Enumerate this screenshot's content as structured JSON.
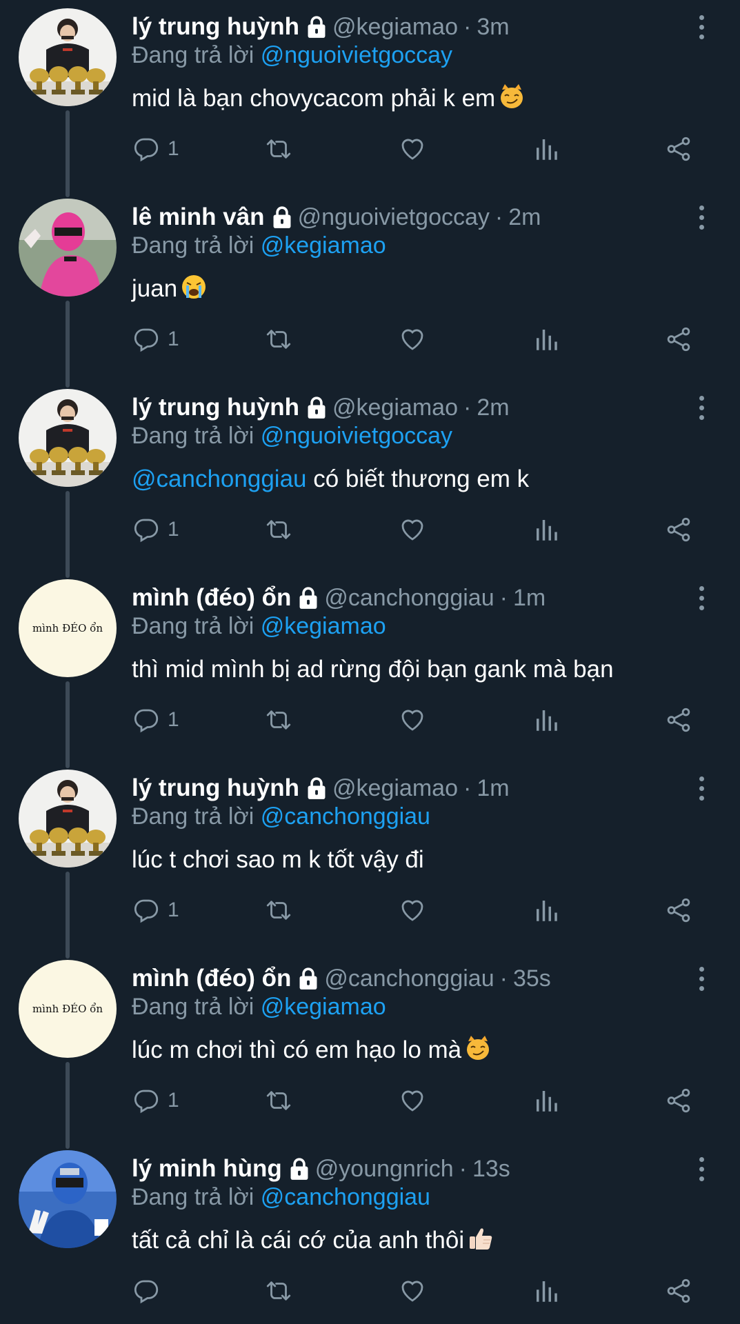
{
  "reply_prefix": "Đang trả lời",
  "tweets": [
    {
      "name": "lý trung huỳnh",
      "handle": "@kegiamao",
      "time": "3m",
      "reply_to": "@nguoivietgoccay",
      "text": "mid là bạn chovycacom phải k em",
      "emoji": "smirk-cat",
      "replies": "1",
      "avatar": "trophies"
    },
    {
      "name": "lê minh vân",
      "handle": "@nguoivietgoccay",
      "time": "2m",
      "reply_to": "@kegiamao",
      "text": "juan",
      "emoji": "crying-face",
      "replies": "1",
      "avatar": "pink-ranger"
    },
    {
      "name": "lý trung huỳnh",
      "handle": "@kegiamao",
      "time": "2m",
      "reply_to": "@nguoivietgoccay",
      "text_mention": "@canchonggiau",
      "text": " có biết thương em k",
      "replies": "1",
      "avatar": "trophies"
    },
    {
      "name": "mình (đéo) ổn",
      "handle": "@canchonggiau",
      "time": "1m",
      "reply_to": "@kegiamao",
      "text": "thì mid mình bị ad rừng đội bạn gank mà bạn",
      "replies": "1",
      "avatar": "text",
      "avatar_text": "mình ĐÉO ổn"
    },
    {
      "name": "lý trung huỳnh",
      "handle": "@kegiamao",
      "time": "1m",
      "reply_to": "@canchonggiau",
      "text": "lúc t chơi sao m k tốt vậy đi",
      "replies": "1",
      "avatar": "trophies"
    },
    {
      "name": "mình (đéo) ổn",
      "handle": "@canchonggiau",
      "time": "35s",
      "reply_to": "@kegiamao",
      "text": "lúc m chơi thì có em hạo lo mà",
      "emoji": "smirk-cat",
      "replies": "1",
      "avatar": "text",
      "avatar_text": "mình ĐÉO ổn"
    },
    {
      "name": "lý minh hùng",
      "handle": "@youngnrich",
      "time": "13s",
      "reply_to": "@canchonggiau",
      "text": "tất cả chỉ là cái cớ của anh thôi",
      "emoji": "thumbs-up",
      "replies": "",
      "avatar": "blue-ranger"
    }
  ],
  "icons": {
    "reply": "comment-bubble-icon",
    "retweet": "retweet-icon",
    "like": "heart-icon",
    "analytics": "analytics-icon",
    "share": "share-icon",
    "more": "vertical-dots-icon",
    "protected": "lock-icon"
  },
  "colors": {
    "background": "#15202b",
    "secondary_text": "#8899a6",
    "link": "#1da1f2",
    "thread_line": "#3d4a57"
  }
}
